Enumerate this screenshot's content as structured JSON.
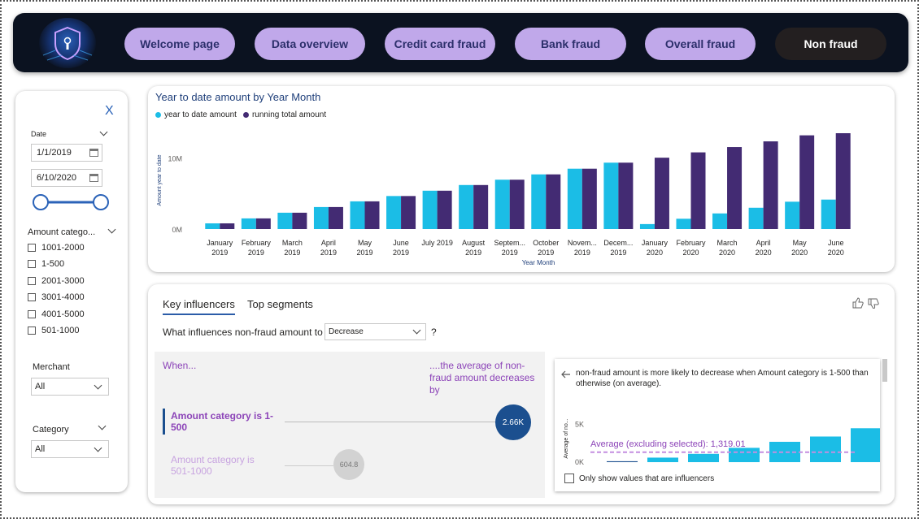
{
  "nav": {
    "logo_icon": "shield-lock-icon",
    "buttons": [
      {
        "label": "Welcome page",
        "active": false
      },
      {
        "label": "Data overview",
        "active": false
      },
      {
        "label": "Credit card fraud",
        "active": false
      },
      {
        "label": "Bank fraud",
        "active": false
      },
      {
        "label": "Overall fraud",
        "active": false
      },
      {
        "label": "Non fraud",
        "active": true
      }
    ]
  },
  "filters": {
    "close_label": "X",
    "date_label": "Date",
    "date_start": "1/1/2019",
    "date_end": "6/10/2020",
    "amount_category_label": "Amount catego...",
    "amount_options": [
      "1001-2000",
      "1-500",
      "2001-3000",
      "3001-4000",
      "4001-5000",
      "501-1000"
    ],
    "merchant_label": "Merchant",
    "merchant_value": "All",
    "category_label": "Category",
    "category_value": "All"
  },
  "chart_data": {
    "type": "bar",
    "title": "Year to date amount by Year Month",
    "xlabel": "Year Month",
    "ylabel": "Amount year to date",
    "y_ticks": [
      "0M",
      "10M"
    ],
    "ylim": [
      0,
      13500000
    ],
    "categories": [
      [
        "January",
        "2019"
      ],
      [
        "February",
        "2019"
      ],
      [
        "March",
        "2019"
      ],
      [
        "April",
        "2019"
      ],
      [
        "May",
        "2019"
      ],
      [
        "June",
        "2019"
      ],
      [
        "July 2019",
        ""
      ],
      [
        "August",
        "2019"
      ],
      [
        "Septem...",
        "2019"
      ],
      [
        "October",
        "2019"
      ],
      [
        "Novem...",
        "2019"
      ],
      [
        "Decem...",
        "2019"
      ],
      [
        "January",
        "2020"
      ],
      [
        "February",
        "2020"
      ],
      [
        "March",
        "2020"
      ],
      [
        "April",
        "2020"
      ],
      [
        "May",
        "2020"
      ],
      [
        "June",
        "2020"
      ]
    ],
    "series": [
      {
        "name": "year to date amount",
        "color": "#1bbde6",
        "values": [
          800000,
          1500000,
          2300000,
          3100000,
          3900000,
          4650000,
          5400000,
          6200000,
          6950000,
          7700000,
          8500000,
          9350000,
          700000,
          1450000,
          2200000,
          3000000,
          3850000,
          4150000
        ]
      },
      {
        "name": "running total amount",
        "color": "#432b73",
        "values": [
          800000,
          1500000,
          2300000,
          3100000,
          3900000,
          4650000,
          5400000,
          6200000,
          6950000,
          7700000,
          8500000,
          9350000,
          10050000,
          10800000,
          11550000,
          12350000,
          13200000,
          13500000
        ]
      }
    ],
    "legend_position": "top-left",
    "grid": false
  },
  "influencers": {
    "tab_key": "Key influencers",
    "tab_segments": "Top segments",
    "question": "What influences non-fraud amount to",
    "direction_value": "Decrease",
    "question_mark": "?",
    "when_label": "When...",
    "result_label": "....the average of non-fraud amount decreases by",
    "items": [
      {
        "label": "Amount category is 1-500",
        "value": "2.66K",
        "selected": true
      },
      {
        "label": "Amount category is 501-1000",
        "value": "604.8",
        "selected": false
      }
    ],
    "detail": {
      "text": "non-fraud amount is more likely to decrease when Amount category is 1-500 than otherwise (on average).",
      "ylabel": "Average of no...",
      "y_ticks": [
        "5K",
        "0K"
      ],
      "average_label": "Average (excluding selected): 1,319.01",
      "average_value": 1319.01,
      "ymax": 5500,
      "bars": [
        120,
        600,
        1100,
        1900,
        2700,
        3400,
        4500
      ],
      "checkbox_label": "Only show values that are influencers"
    }
  }
}
